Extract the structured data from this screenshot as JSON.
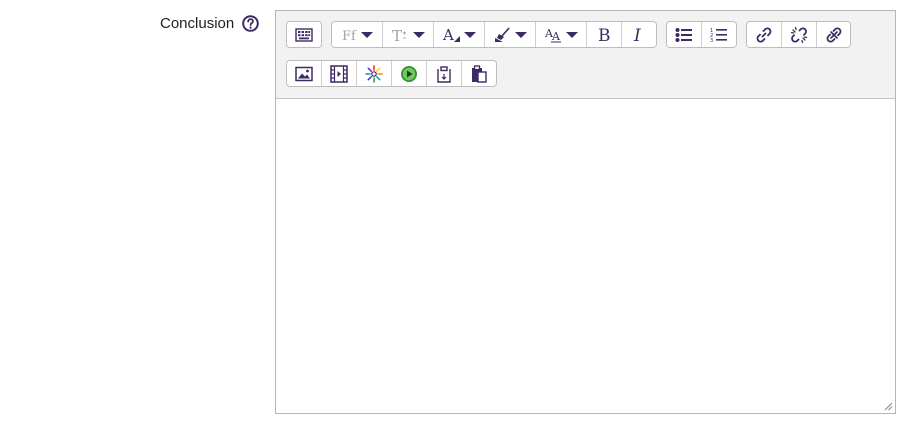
{
  "field": {
    "label": "Conclusion",
    "help_icon": "question-circle-icon"
  },
  "colors": {
    "icon": "#3d2a63",
    "border": "#b6b6b6",
    "toolbar_bg": "#f2f2f2",
    "label": "#1d2125"
  },
  "toolbar": {
    "row1": [
      {
        "group": "collapse",
        "buttons": [
          {
            "icon": "toolbar-collapse-icon"
          }
        ]
      },
      {
        "group": "style",
        "buttons": [
          {
            "icon": "font-family-icon",
            "glyph": "Ff",
            "dropdown": true
          },
          {
            "icon": "font-size-icon",
            "glyph": "T",
            "dropdown": true
          },
          {
            "icon": "font-color-icon",
            "glyph": "A",
            "dropdown": true
          },
          {
            "icon": "background-color-icon",
            "dropdown": true
          },
          {
            "icon": "text-style-icon",
            "glyph": "AA",
            "dropdown": true
          },
          {
            "icon": "bold-icon",
            "glyph": "B"
          },
          {
            "icon": "italic-icon",
            "glyph": "I"
          }
        ]
      },
      {
        "group": "list",
        "buttons": [
          {
            "icon": "unordered-list-icon"
          },
          {
            "icon": "ordered-list-icon"
          }
        ]
      },
      {
        "group": "links",
        "buttons": [
          {
            "icon": "link-icon"
          },
          {
            "icon": "unlink-icon"
          },
          {
            "icon": "remove-link-icon"
          }
        ]
      }
    ],
    "row2": [
      {
        "group": "files",
        "buttons": [
          {
            "icon": "image-icon"
          },
          {
            "icon": "media-icon"
          },
          {
            "icon": "h5p-icon"
          },
          {
            "icon": "record-video-icon"
          },
          {
            "icon": "paste-text-icon"
          },
          {
            "icon": "paste-clipboard-icon"
          }
        ]
      }
    ]
  },
  "editor": {
    "content": ""
  }
}
